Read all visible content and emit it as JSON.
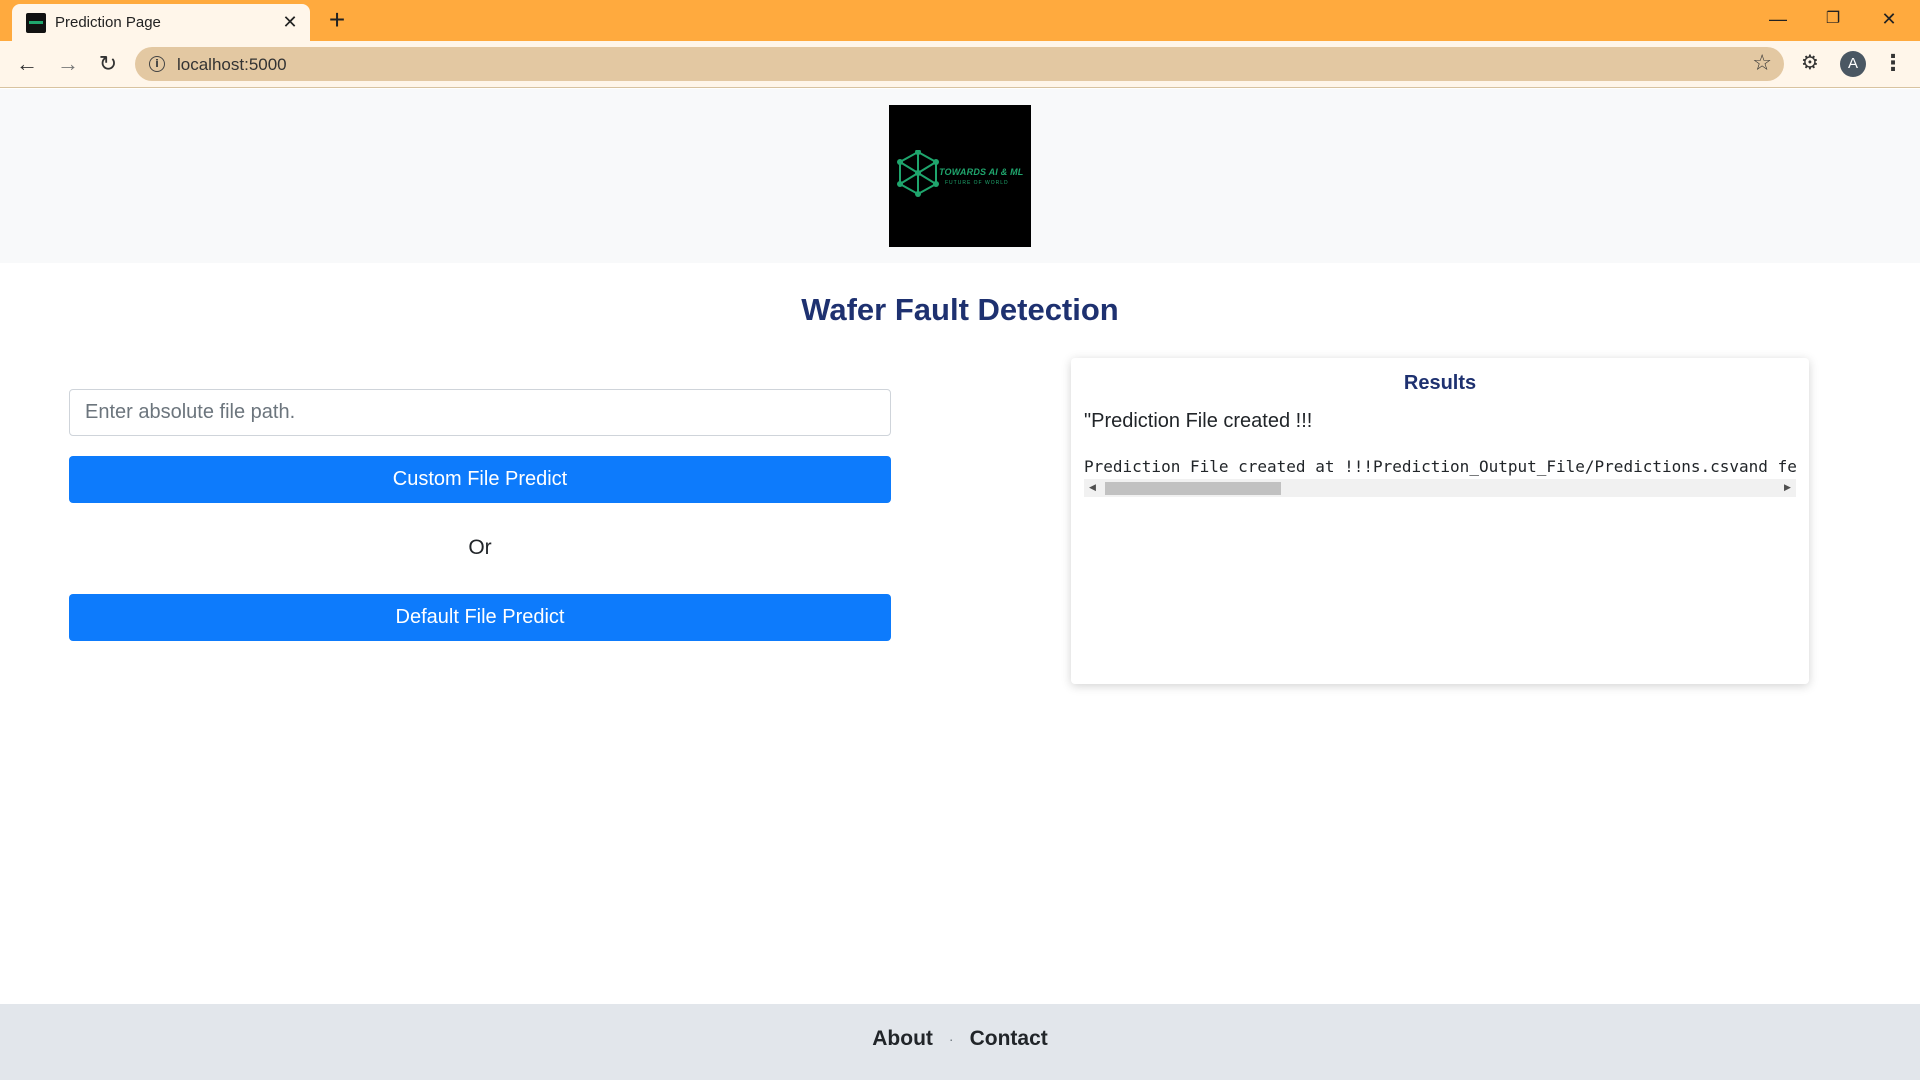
{
  "browser": {
    "tab_title": "Prediction Page",
    "tab_close": "✕",
    "new_tab": "+",
    "url": "localhost:5000",
    "avatar_letter": "A",
    "window_controls": {
      "minimize": "—",
      "restore": "❐",
      "close": "✕"
    }
  },
  "logo": {
    "text": "TOWARDS AI & ML",
    "subtext": "FUTURE OF WORLD"
  },
  "page": {
    "title": "Wafer Fault Detection"
  },
  "form": {
    "path_placeholder": "Enter absolute file path.",
    "path_value": "",
    "custom_button": "Custom File Predict",
    "or_label": "Or",
    "default_button": "Default File Predict"
  },
  "results": {
    "title": "Results",
    "message": "\"Prediction File created !!!",
    "detail": "Prediction File created at !!!Prediction_Output_File/Predictions.csvand few of the predictions are"
  },
  "footer": {
    "about": "About",
    "separator": "·",
    "contact": "Contact"
  },
  "colors": {
    "browser_frame": "#FFAA3E",
    "browser_toolbar": "#FFF6EA",
    "omnibox": "#E3C8A2",
    "primary_button": "#0D7BFC",
    "title_text": "#1E3170",
    "header_band": "#F8F9FA",
    "footer_band": "#E2E6EB"
  }
}
